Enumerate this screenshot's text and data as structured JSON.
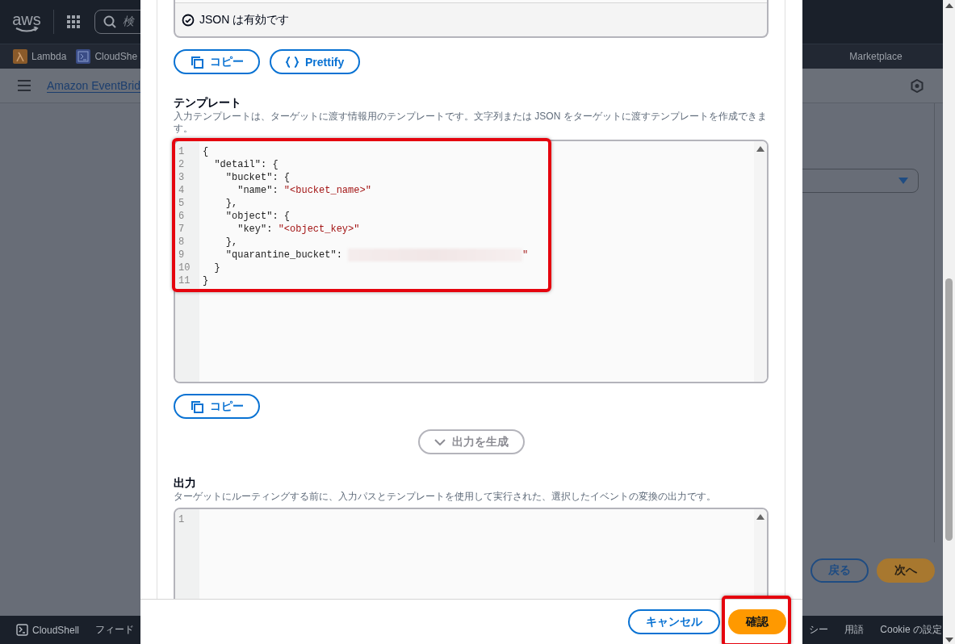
{
  "console": {
    "logo": "aws",
    "search": {
      "placeholder": "検"
    },
    "favorites": [
      {
        "kind": "lambda",
        "label": "Lambda"
      },
      {
        "kind": "cloudshell",
        "label": "CloudShe"
      },
      {
        "kind": "plain",
        "label": "Marketplace"
      }
    ],
    "breadcrumb": "Amazon EventBrid",
    "buttons": [
      {
        "kind": "secondary",
        "label": "戻る"
      },
      {
        "kind": "primary",
        "label": "次へ"
      }
    ],
    "footer": {
      "cloudshell": "CloudShell",
      "links_left": [
        "フィード"
      ],
      "links_right": [
        "シー",
        "用語",
        "Cookie の設定"
      ]
    }
  },
  "modal": {
    "validation": "JSON は有効です",
    "path_buttons": [
      {
        "kind": "copy",
        "label": "コピー"
      },
      {
        "kind": "braces",
        "label": "Prettify"
      }
    ],
    "template": {
      "title": "テンプレート",
      "description": "入力テンプレートは、ターゲットに渡す情報用のテンプレートです。文字列または JSON をターゲットに渡すテンプレートを作成できます。",
      "highlighted": true,
      "lines": [
        {
          "number": "1",
          "parts": [
            {
              "kind": "plain",
              "text": "{"
            }
          ]
        },
        {
          "number": "2",
          "parts": [
            {
              "kind": "plain",
              "text": "  \"detail\": {"
            }
          ]
        },
        {
          "number": "3",
          "parts": [
            {
              "kind": "plain",
              "text": "    \"bucket\": {"
            }
          ]
        },
        {
          "number": "4",
          "parts": [
            {
              "kind": "plain",
              "text": "      \"name\": "
            },
            {
              "kind": "string",
              "text": "\"<bucket_name>\""
            }
          ]
        },
        {
          "number": "5",
          "parts": [
            {
              "kind": "plain",
              "text": "    },"
            }
          ]
        },
        {
          "number": "6",
          "parts": [
            {
              "kind": "plain",
              "text": "    \"object\": {"
            }
          ]
        },
        {
          "number": "7",
          "parts": [
            {
              "kind": "plain",
              "text": "      \"key\": "
            },
            {
              "kind": "string",
              "text": "\"<object_key>\""
            }
          ]
        },
        {
          "number": "8",
          "parts": [
            {
              "kind": "plain",
              "text": "    },"
            }
          ]
        },
        {
          "number": "9",
          "parts": [
            {
              "kind": "plain",
              "text": "    \"quarantine_bucket\": "
            },
            {
              "kind": "redacted"
            },
            {
              "kind": "string",
              "text": "\""
            }
          ]
        },
        {
          "number": "10",
          "parts": [
            {
              "kind": "plain",
              "text": "  }"
            }
          ]
        },
        {
          "number": "11",
          "parts": [
            {
              "kind": "plain",
              "text": "}"
            }
          ]
        }
      ],
      "buttons": [
        {
          "kind": "copy",
          "label": "コピー"
        }
      ]
    },
    "generate_button": {
      "label": "出力を生成",
      "disabled": true
    },
    "output": {
      "title": "出力",
      "description": "ターゲットにルーティングする前に、入力パスとテンプレートを使用して実行された、選択したイベントの変換の出力です。",
      "lines": [
        {
          "number": "1"
        }
      ]
    },
    "footer_buttons": [
      {
        "kind": "secondary",
        "label": "キャンセル",
        "highlighted": false
      },
      {
        "kind": "primary",
        "label": "確認",
        "highlighted": true
      }
    ]
  }
}
